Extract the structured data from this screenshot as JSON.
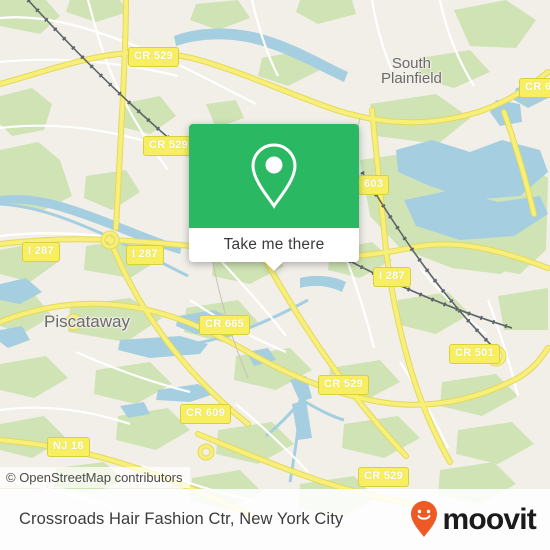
{
  "map": {
    "attribution": "© OpenStreetMap contributors",
    "base_color": "#f2efe9",
    "green_color": "#cfe3b4",
    "water_color": "#a5cfe0",
    "road_color": "#f5e96e",
    "places": [
      {
        "name": "South Plainfield",
        "line1": "South",
        "line2": "Plainfield"
      },
      {
        "name": "Piscataway",
        "line1": "Piscataway",
        "line2": ""
      }
    ],
    "shields": [
      {
        "label": "CR 529"
      },
      {
        "label": "CR 529"
      },
      {
        "label": "CR 6"
      },
      {
        "label": "603"
      },
      {
        "label": "I 287"
      },
      {
        "label": "I 287"
      },
      {
        "label": "I 287"
      },
      {
        "label": "CR 665"
      },
      {
        "label": "CR 501"
      },
      {
        "label": "CR 529"
      },
      {
        "label": "CR 609"
      },
      {
        "label": "NJ 18"
      },
      {
        "label": "CR 529"
      }
    ]
  },
  "popup": {
    "accent_color": "#2bb862",
    "icon": "map-pin-icon",
    "action_label": "Take me there"
  },
  "footer": {
    "title": "Crossroads Hair Fashion Ctr, New York City",
    "brand": "moovit",
    "brand_color": "#ee5a24"
  }
}
